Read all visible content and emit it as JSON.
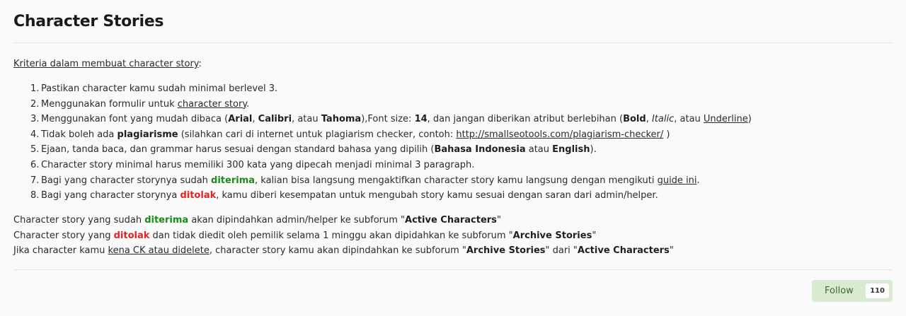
{
  "title": "Character Stories",
  "intro": {
    "link": "Kriteria dalam membuat character story",
    "suffix": ":"
  },
  "criteria": [
    {
      "num": "1.",
      "parts": [
        {
          "t": "Pastikan character kamu sudah minimal berlevel 3."
        }
      ]
    },
    {
      "num": "2.",
      "parts": [
        {
          "t": "Menggunakan formulir untuk "
        },
        {
          "t": "character story",
          "s": "link"
        },
        {
          "t": "."
        }
      ]
    },
    {
      "num": "3.",
      "parts": [
        {
          "t": "Menggunakan font yang mudah dibaca ("
        },
        {
          "t": "Arial",
          "s": "bold"
        },
        {
          "t": ", "
        },
        {
          "t": "Calibri",
          "s": "bold"
        },
        {
          "t": ", atau "
        },
        {
          "t": "Tahoma",
          "s": "bold"
        },
        {
          "t": "),Font size: "
        },
        {
          "t": "14",
          "s": "bold"
        },
        {
          "t": ", dan jangan diberikan atribut berlebihan ("
        },
        {
          "t": "Bold",
          "s": "bold"
        },
        {
          "t": ", "
        },
        {
          "t": "Italic",
          "s": "italic"
        },
        {
          "t": ", atau "
        },
        {
          "t": "Underline",
          "s": "link"
        },
        {
          "t": ")"
        }
      ]
    },
    {
      "num": "4.",
      "parts": [
        {
          "t": "Tidak boleh ada "
        },
        {
          "t": "plagiarisme",
          "s": "bold"
        },
        {
          "t": " (silahkan cari di internet untuk plagiarism checker, contoh: "
        },
        {
          "t": "http://smallseotools.com/plagiarism-checker/",
          "s": "link"
        },
        {
          "t": " )"
        }
      ]
    },
    {
      "num": "5.",
      "parts": [
        {
          "t": "Ejaan, tanda baca, dan grammar harus sesuai dengan standard bahasa yang dipilih ("
        },
        {
          "t": "Bahasa Indonesia",
          "s": "bold"
        },
        {
          "t": " atau "
        },
        {
          "t": "English",
          "s": "bold"
        },
        {
          "t": ")."
        }
      ]
    },
    {
      "num": "6.",
      "parts": [
        {
          "t": "Character story minimal harus memiliki 300 kata yang dipecah menjadi minimal 3 paragraph."
        }
      ]
    },
    {
      "num": "7.",
      "parts": [
        {
          "t": "Bagi yang character storynya sudah "
        },
        {
          "t": "diterima",
          "s": "green"
        },
        {
          "t": ", kalian bisa langsung mengaktifkan character story kamu langsung dengan mengikuti "
        },
        {
          "t": "guide ini",
          "s": "link"
        },
        {
          "t": "."
        }
      ]
    },
    {
      "num": "8.",
      "parts": [
        {
          "t": "Bagi yang character storynya "
        },
        {
          "t": "ditolak",
          "s": "red"
        },
        {
          "t": ", kamu diberi kesempatan untuk mengubah story kamu sesuai dengan saran dari admin/helper."
        }
      ]
    }
  ],
  "notes": [
    {
      "parts": [
        {
          "t": "Character story yang sudah "
        },
        {
          "t": "diterima",
          "s": "green"
        },
        {
          "t": " akan dipindahkan admin/helper ke subforum \""
        },
        {
          "t": "Active Characters",
          "s": "bold"
        },
        {
          "t": "\""
        }
      ]
    },
    {
      "parts": [
        {
          "t": "Character story yang "
        },
        {
          "t": "ditolak",
          "s": "red"
        },
        {
          "t": " dan tidak diedit oleh pemilik selama 1 minggu akan dipidahkan ke subforum \""
        },
        {
          "t": "Archive Stories",
          "s": "bold"
        },
        {
          "t": "\""
        }
      ]
    },
    {
      "parts": [
        {
          "t": "Jika character kamu "
        },
        {
          "t": "kena CK atau didelete",
          "s": "link"
        },
        {
          "t": ", character story kamu akan dipindahkan ke subforum \""
        },
        {
          "t": "Archive Stories",
          "s": "bold"
        },
        {
          "t": "\" dari \""
        },
        {
          "t": "Active Characters",
          "s": "bold"
        },
        {
          "t": "\""
        }
      ]
    }
  ],
  "follow": {
    "label": "Follow",
    "count": "110"
  },
  "colors": {
    "green": "#1a8a1a",
    "red": "#e52222",
    "follow_bg": "#d8ead0"
  }
}
